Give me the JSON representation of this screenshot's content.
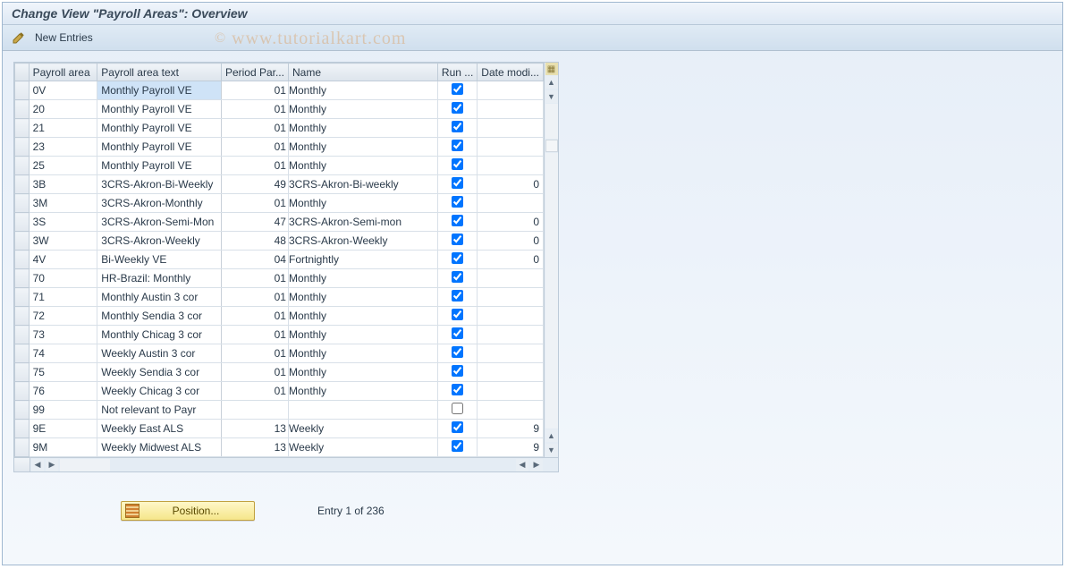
{
  "title": "Change View \"Payroll Areas\": Overview",
  "toolbar": {
    "new_entries": "New Entries"
  },
  "watermark": "www.tutorialkart.com",
  "columns": {
    "payroll_area": "Payroll area",
    "payroll_text": "Payroll area text",
    "period_par": "Period Par...",
    "name": "Name",
    "run": "Run ...",
    "date_modi": "Date modi..."
  },
  "rows": [
    {
      "pa": "0V",
      "txt": "Monthly Payroll  VE",
      "pp": "01",
      "name": "Monthly",
      "run": true,
      "dm": "",
      "sel": true
    },
    {
      "pa": "20",
      "txt": "Monthly Payroll  VE",
      "pp": "01",
      "name": "Monthly",
      "run": true,
      "dm": ""
    },
    {
      "pa": "21",
      "txt": "Monthly Payroll  VE",
      "pp": "01",
      "name": "Monthly",
      "run": true,
      "dm": ""
    },
    {
      "pa": "23",
      "txt": "Monthly Payroll  VE",
      "pp": "01",
      "name": "Monthly",
      "run": true,
      "dm": ""
    },
    {
      "pa": "25",
      "txt": "Monthly Payroll  VE",
      "pp": "01",
      "name": "Monthly",
      "run": true,
      "dm": ""
    },
    {
      "pa": "3B",
      "txt": "3CRS-Akron-Bi-Weekly",
      "pp": "49",
      "name": "3CRS-Akron-Bi-weekly",
      "run": true,
      "dm": "0"
    },
    {
      "pa": "3M",
      "txt": "3CRS-Akron-Monthly",
      "pp": "01",
      "name": "Monthly",
      "run": true,
      "dm": ""
    },
    {
      "pa": "3S",
      "txt": "3CRS-Akron-Semi-Mon",
      "pp": "47",
      "name": "3CRS-Akron-Semi-mon",
      "run": true,
      "dm": "0"
    },
    {
      "pa": "3W",
      "txt": "3CRS-Akron-Weekly",
      "pp": "48",
      "name": "3CRS-Akron-Weekly",
      "run": true,
      "dm": "0"
    },
    {
      "pa": "4V",
      "txt": "Bi-Weekly VE",
      "pp": "04",
      "name": "Fortnightly",
      "run": true,
      "dm": "0"
    },
    {
      "pa": "70",
      "txt": "HR-Brazil: Monthly",
      "pp": "01",
      "name": "Monthly",
      "run": true,
      "dm": ""
    },
    {
      "pa": "71",
      "txt": "Monthly Austin 3 cor",
      "pp": "01",
      "name": "Monthly",
      "run": true,
      "dm": ""
    },
    {
      "pa": "72",
      "txt": "Monthly Sendia 3 cor",
      "pp": "01",
      "name": "Monthly",
      "run": true,
      "dm": ""
    },
    {
      "pa": "73",
      "txt": "Monthly Chicag 3 cor",
      "pp": "01",
      "name": "Monthly",
      "run": true,
      "dm": ""
    },
    {
      "pa": "74",
      "txt": "Weekly Austin 3 cor",
      "pp": "01",
      "name": "Monthly",
      "run": true,
      "dm": ""
    },
    {
      "pa": "75",
      "txt": "Weekly Sendia 3 cor",
      "pp": "01",
      "name": "Monthly",
      "run": true,
      "dm": ""
    },
    {
      "pa": "76",
      "txt": "Weekly Chicag 3 cor",
      "pp": "01",
      "name": "Monthly",
      "run": true,
      "dm": ""
    },
    {
      "pa": "99",
      "txt": "Not relevant to Payr",
      "pp": "",
      "name": "",
      "run": false,
      "dm": ""
    },
    {
      "pa": "9E",
      "txt": "Weekly East ALS",
      "pp": "13",
      "name": "Weekly",
      "run": true,
      "dm": "9"
    },
    {
      "pa": "9M",
      "txt": "Weekly Midwest ALS",
      "pp": "13",
      "name": "Weekly",
      "run": true,
      "dm": "9"
    }
  ],
  "position_button": "Position...",
  "entry_text": "Entry 1 of 236"
}
